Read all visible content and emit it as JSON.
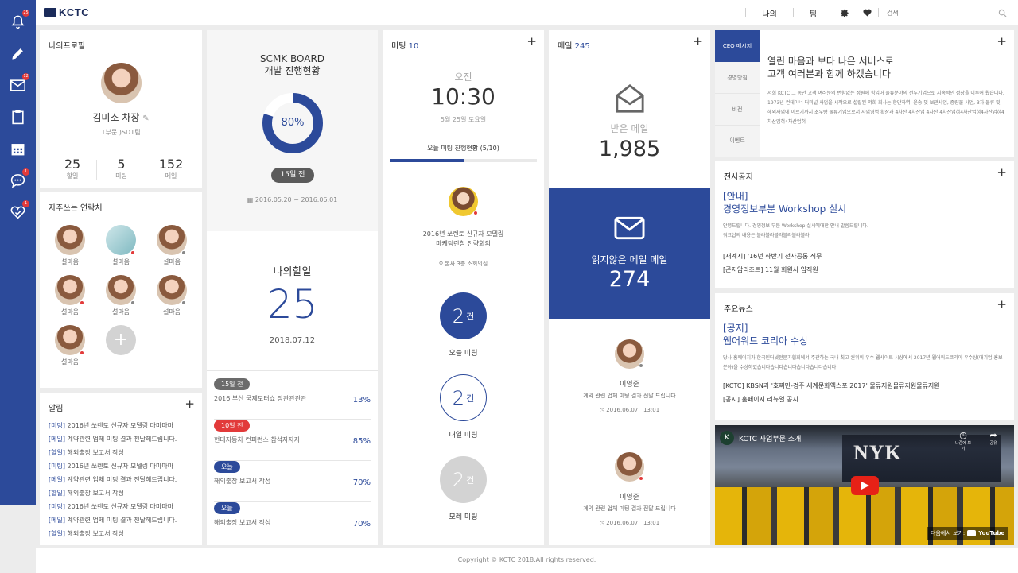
{
  "header": {
    "logo": "KCTC",
    "nav_my": "나의",
    "nav_team": "팀",
    "search_placeholder": "검색"
  },
  "sidebar": {
    "alarm_badge": "25",
    "mail_badge": "12",
    "chat_badge": "1",
    "heart_badge": "1"
  },
  "profile": {
    "title": "나의프로필",
    "name": "김미소 차장",
    "dept": "1부문 )SD1팀",
    "stats": [
      {
        "value": "25",
        "label": "할일"
      },
      {
        "value": "5",
        "label": "미팅"
      },
      {
        "value": "152",
        "label": "메일"
      }
    ]
  },
  "contacts": {
    "title": "자주쓰는 연락처",
    "items": [
      "설마음",
      "설마음",
      "설마음",
      "설마음",
      "설마음",
      "설마음",
      "설마음"
    ]
  },
  "alerts": {
    "title": "알림",
    "items": [
      {
        "tag": "[미팅]",
        "text": "2016년 쏘렌토 신규자 모델링 마마마마"
      },
      {
        "tag": "[메일]",
        "text": "계약관련 업체 미팅 결과 전달해드립니다."
      },
      {
        "tag": "[할일]",
        "text": "해외출장 보고서 작성"
      },
      {
        "tag": "[미팅]",
        "text": "2016년 쏘렌토 신규자 모델링 마마마마"
      },
      {
        "tag": "[메일]",
        "text": "계약관련 업체 미팅 결과 전달해드립니다."
      },
      {
        "tag": "[할일]",
        "text": "해외출장 보고서 작성"
      },
      {
        "tag": "[미팅]",
        "text": "2016년 쏘렌토 신규자 모델링 마마마마"
      },
      {
        "tag": "[메일]",
        "text": "계약관련 업체 미팅 결과 전달해드립니다."
      },
      {
        "tag": "[할일]",
        "text": "해외출장 보고서 작성"
      }
    ]
  },
  "scmk": {
    "title1": "SCMK BOARD",
    "title2": "개발 진행현황",
    "percent": "80%",
    "progress": 0.8,
    "dday": "15일 전",
    "period": "2016.05.20 ~ 2016.06.01"
  },
  "todo": {
    "title": "나의할일",
    "count": "25",
    "date": "2018.07.12",
    "items": [
      {
        "tag": "15일 전",
        "tag_color": "#6b6b6b",
        "text": "2016 부산 국제모터쇼 장관관관관",
        "pct": "13%"
      },
      {
        "tag": "10일 전",
        "tag_color": "#e23a3a",
        "text": "현대자동차 컨퍼런스 참석자자자",
        "pct": "85%"
      },
      {
        "tag": "오늘",
        "tag_color": "#2c4a9a",
        "text": "해외출장 보고서 작성",
        "pct": "70%"
      },
      {
        "tag": "오늘",
        "tag_color": "#2c4a9a",
        "text": "해외출장 보고서 작성",
        "pct": "70%"
      }
    ]
  },
  "meeting": {
    "title": "미팅",
    "count": "10",
    "ampm": "오전",
    "time": "10:30",
    "date": "5월 25일 토요일",
    "progress_label": "오늘 미팅 진행현황 (5/10)",
    "progress": 0.5,
    "next_title1": "2016년 쏘렌토 신규자 모델링",
    "next_title2": "마케팅런칭 전략회의",
    "location": "본사 3층 소회의실",
    "today": {
      "value": "2",
      "unit": "건",
      "label": "오늘 미팅"
    },
    "tomorrow": {
      "value": "2",
      "unit": "건",
      "label": "내일 미팅"
    },
    "dayafter": {
      "value": "2",
      "unit": "건",
      "label": "모레 미팅"
    }
  },
  "mail": {
    "title": "메일",
    "count": "245",
    "received_label": "받은 메일",
    "received": "1,985",
    "unread_label": "읽지않은 메일 메일",
    "unread": "274",
    "items": [
      {
        "name": "이영준",
        "text": "계약 관련 업체 미팅 결과 전달 드립니다",
        "date": "2016.06.07",
        "time": "13:01"
      },
      {
        "name": "이영준",
        "text": "계약 관련 업체 미팅 결과 전달 드립니다",
        "date": "2016.06.07",
        "time": "13:01"
      }
    ]
  },
  "ceo": {
    "tabs": [
      "CEO 메시지",
      "경영방침",
      "비전",
      "이벤트"
    ],
    "headline1": "열린 마음과 보다 나은 서비스로",
    "headline2": "고객 여러분과 함께 하겠습니다",
    "body": "저희 KCTC 그 동안 고객 여러분의 변함없는 성원에 힘입어 물류분야의 선두기업으로 지속적인 성장을 이루어 왔습니다. 1973년 컨테이너 터미널 사업을 시작으로 설립된 저희 회사는 항만하역, 운송 및 보관사업, 중량물 사업, 3자 물류 및 해외사업에 이르기까지 초우량 물류기업으로서 사업영역 확장과 4차산 4차산업 4차산 4차산업혀4차산업혀4차산업혀4차산업혀4차산업혀"
  },
  "corp_notice": {
    "title": "전사공지",
    "headline1": "[안내]",
    "headline2": "경영정보부분 Workshop 실시",
    "body1": "안녕드립니다. 경영정보 부분 Workshop 실시에대한 안내 말씀드립니다.",
    "body2": "워크샵의 내용은 블라블라블라블라블라블라",
    "links": [
      "[재계시] '16년 하반기 전사공통 직무",
      "[곤지암리조트] 11월 회원사 임직원"
    ]
  },
  "news": {
    "title": "주요뉴스",
    "headline1": "[공지]",
    "headline2": "웹어워드 코리아 수상",
    "body": "당사 홈페이지가 한국인터넷전문가협회에서 주관하는 국내 최고 권위의 우수 웹사이트 시상에서 2017년 웹어워드코리아 우수상(대기업 홍보분야)을 수상하였습니다습니다습니다습니다습니다습니다",
    "links": [
      "[KCTC] KBSN과 '호찌민-경주 세계문화엑스포 2017' 물류지원물류지원물류지원",
      "[공지] 홈페이지 리뉴얼 공지"
    ]
  },
  "video": {
    "channel_initial": "K",
    "title": "KCTC 사업부문 소개",
    "later": "나중에 보기",
    "share": "공유",
    "watch_on": "다음에서 보기:",
    "yt": "YouTube",
    "ship_text": "NYK"
  },
  "footer": {
    "copyright": "Copyright © KCTC 2018.All rights reserved."
  },
  "colors": {
    "primary": "#2c4a9a",
    "badge": "#e23a3a",
    "gray_circle": "#d3d3d3"
  }
}
